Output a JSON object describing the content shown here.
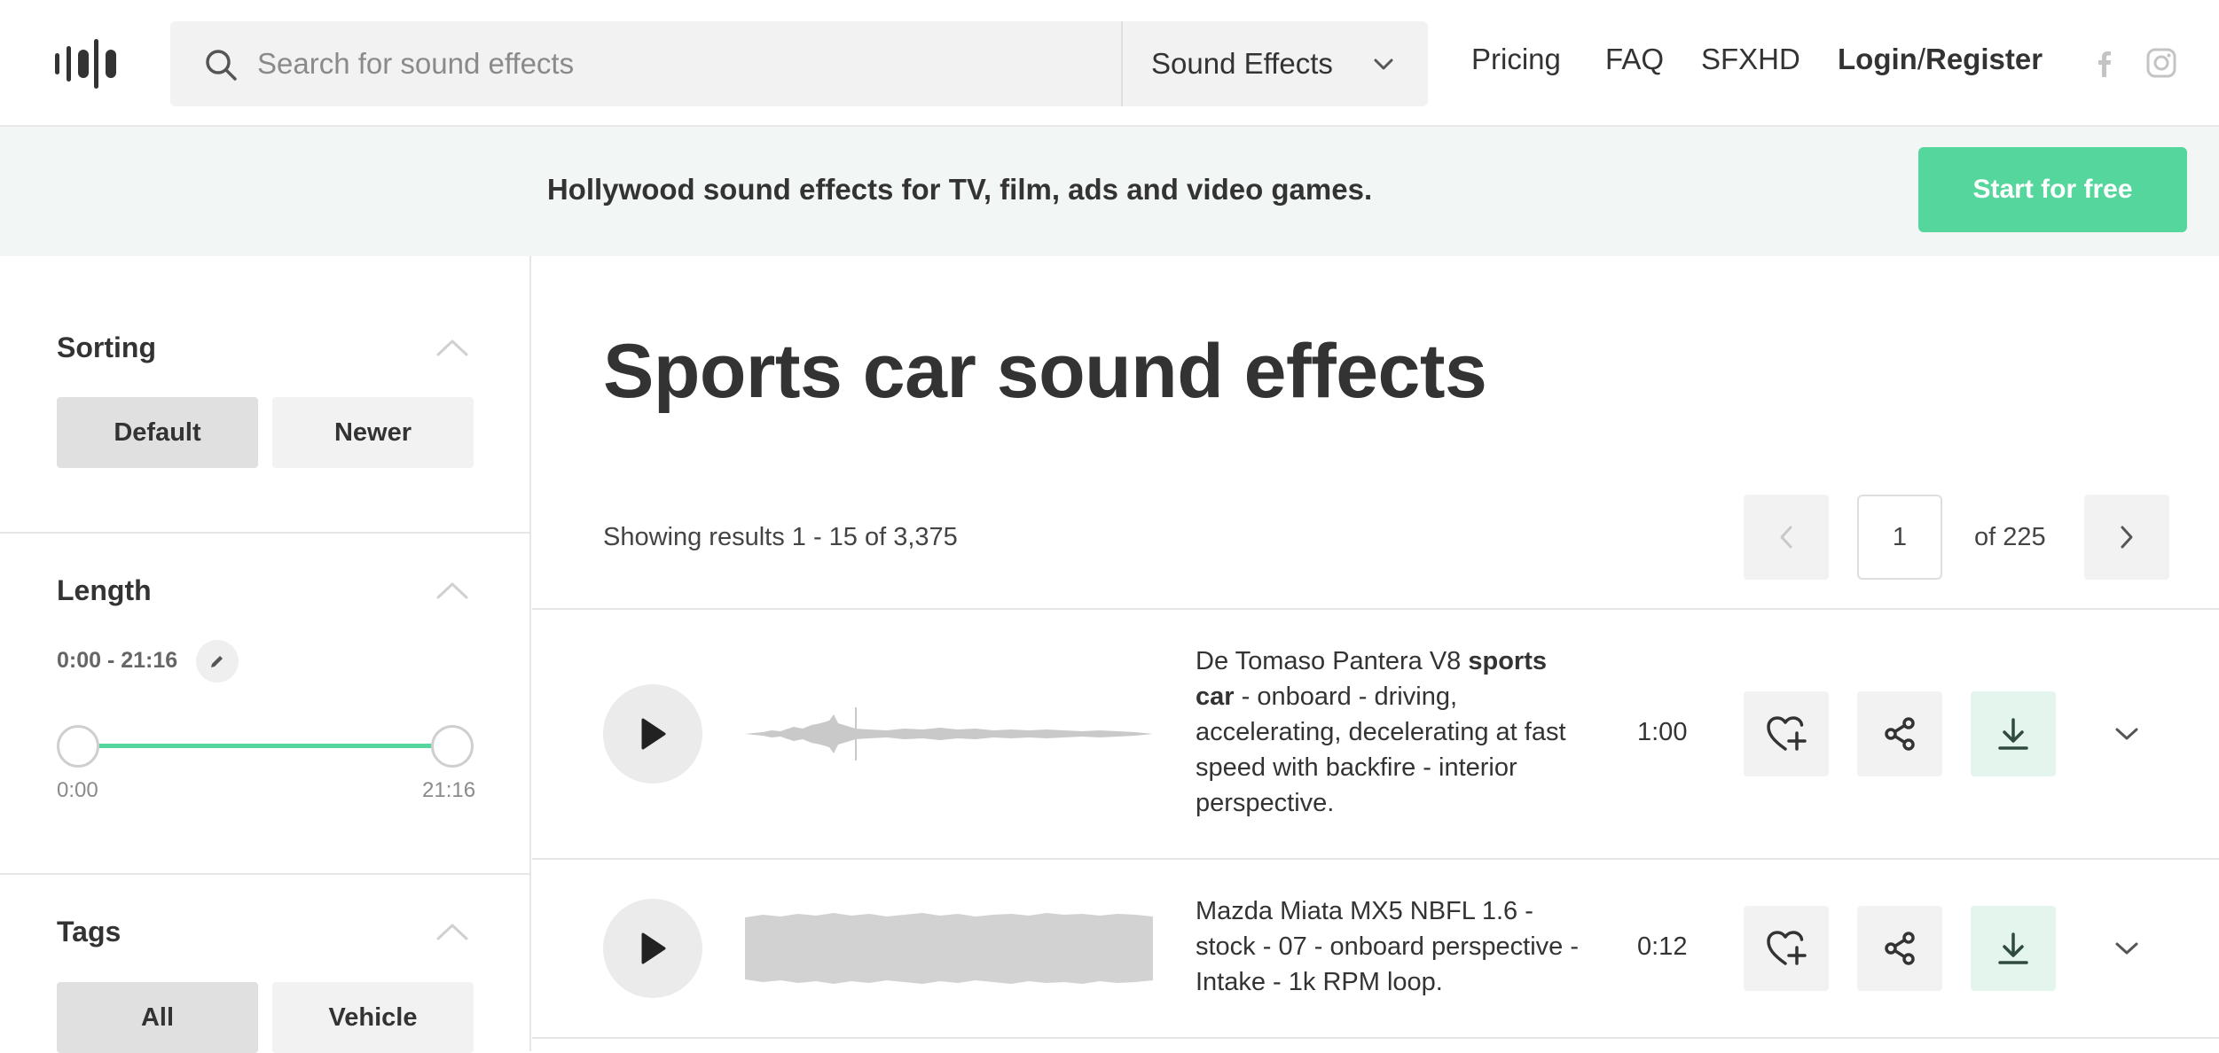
{
  "header": {
    "logo_name": "logo",
    "search": {
      "placeholder": "Search for sound effects",
      "value": ""
    },
    "category": "Sound Effects",
    "nav": {
      "pricing": "Pricing",
      "faq": "FAQ",
      "sfxhd": "SFXHD",
      "login": "Login",
      "slash": "/",
      "register": "Register"
    },
    "social": [
      "facebook-icon",
      "instagram-icon"
    ]
  },
  "banner": {
    "text": "Hollywood sound effects for TV, film, ads and video games.",
    "cta": "Start for free",
    "cta_color": "#55d69d"
  },
  "sidebar": {
    "sorting": {
      "title": "Sorting",
      "options": [
        "Default",
        "Newer"
      ],
      "selected": "Default"
    },
    "length": {
      "title": "Length",
      "range_text": "0:00 - 21:16",
      "min_label": "0:00",
      "max_label": "21:16"
    },
    "tags": {
      "title": "Tags",
      "options": [
        "All",
        "Vehicle"
      ],
      "selected": "All"
    }
  },
  "main": {
    "title": "Sports car sound effects",
    "results_text": "Showing results 1 - 15 of 3,375",
    "pagination": {
      "current": "1",
      "of_text": "of 225"
    },
    "sounds": [
      {
        "desc_before": "De Tomaso Pantera V8 ",
        "desc_bold": "sports car",
        "desc_after": " - onboard - driving, accelerating, decelerating at fast speed with backfire - interior perspective.",
        "duration": "1:00"
      },
      {
        "desc_before": "Mazda Miata MX5 NBFL 1.6 - stock - 07 - onboard perspective - Intake - 1k RPM loop.",
        "desc_bold": "",
        "desc_after": "",
        "duration": "0:12"
      }
    ]
  }
}
